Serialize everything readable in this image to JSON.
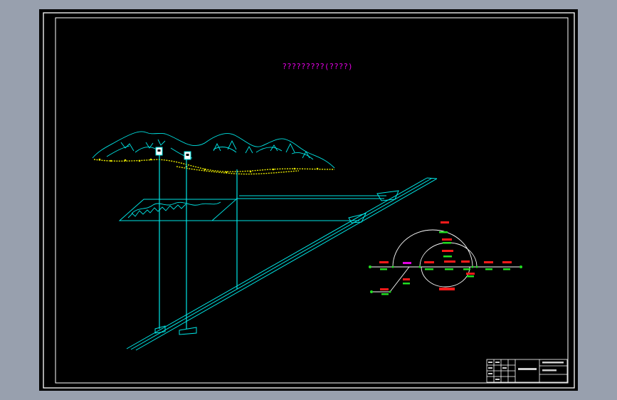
{
  "drawing": {
    "title": "?????????(????)"
  },
  "colors": {
    "viewport_bg": "#98a0ae",
    "paper": "#000000",
    "frame": "#ffffff",
    "geometry": "#00e5e5",
    "terrain_fill": "#e8e800",
    "node_red": "#ff1a1a",
    "node_green": "#22dd22",
    "highlight": "#e400e4"
  },
  "icons": {
    "equipment_markers": [
      "wellhead-icon",
      "wellhead-icon"
    ]
  }
}
